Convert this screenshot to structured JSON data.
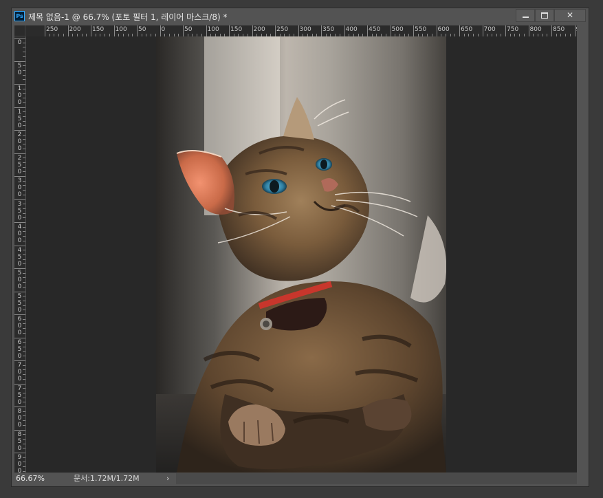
{
  "window": {
    "app_icon": "Ps",
    "title": "제목 없음-1 @ 66.7% (포토 필터 1, 레이어 마스크/8) *",
    "close_glyph": "✕"
  },
  "ruler_h_labels": [
    "250",
    "200",
    "150",
    "100",
    "50",
    "0",
    "50",
    "100",
    "150",
    "200",
    "250",
    "300",
    "350",
    "400",
    "450",
    "500",
    "550",
    "600",
    "650",
    "700",
    "750",
    "800",
    "850",
    "90"
  ],
  "ruler_v_labels": [
    "0",
    "50",
    "100",
    "150",
    "200",
    "250",
    "300",
    "350",
    "400",
    "450",
    "500",
    "550",
    "600",
    "650",
    "700",
    "750",
    "800",
    "850",
    "900"
  ],
  "status": {
    "zoom": "66.67%",
    "doc_info": "문서:1.72M/1.72M",
    "arrow": "›"
  },
  "image": {
    "subject": "tabby cat with blue eyes and red collar looking up",
    "colors": {
      "background": "#3d3a36",
      "fur": "#6e5236",
      "collar": "#b8322a",
      "eye": "#3d8fb0",
      "ear": "#e0805a"
    }
  },
  "colors": {
    "canvas_bg": "#282828",
    "panel": "#535353",
    "ruler": "#2b2b2b",
    "accent": "#31a8ff"
  }
}
